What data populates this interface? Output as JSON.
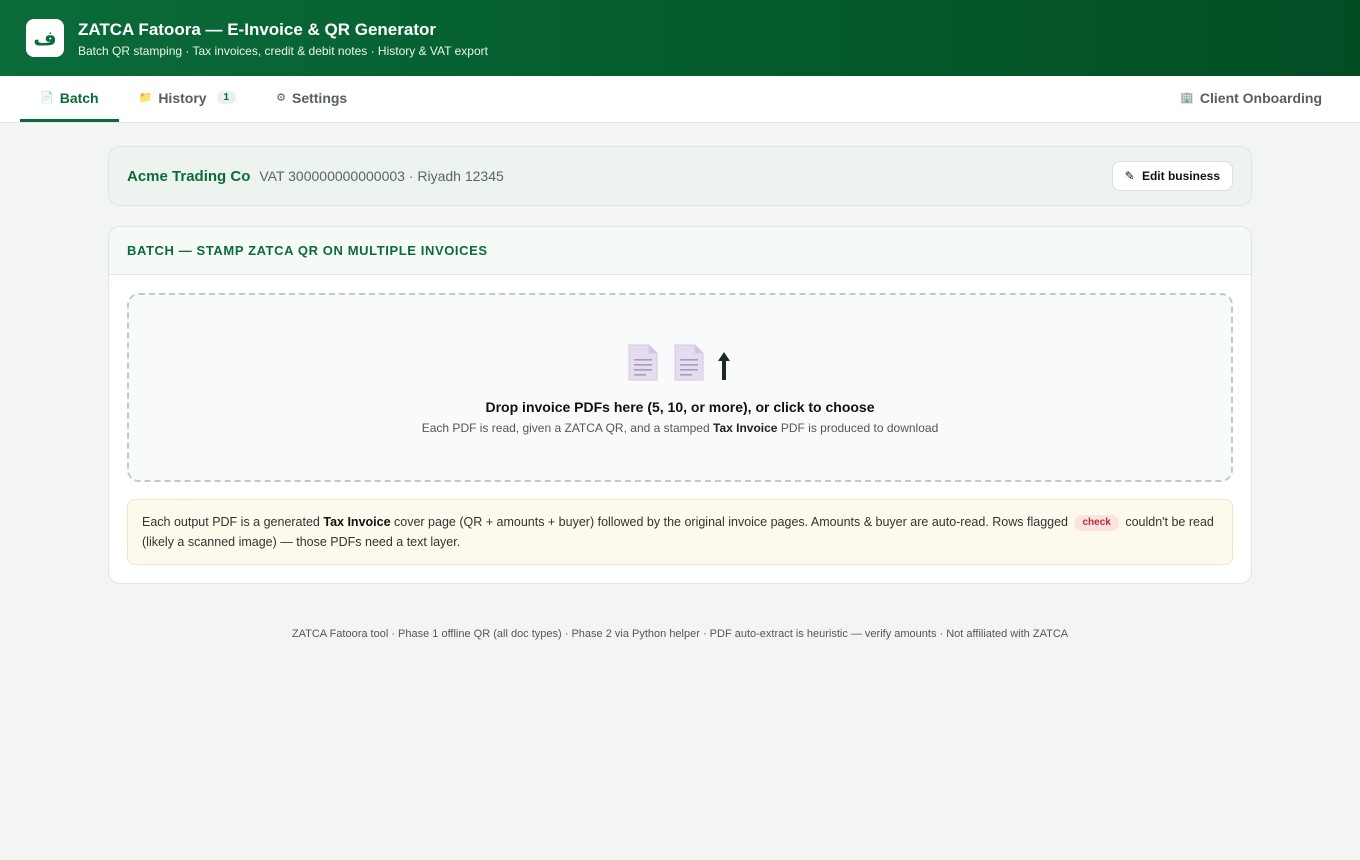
{
  "header": {
    "logo_glyph": "ف",
    "title": "ZATCA Fatoora — E-Invoice & QR Generator",
    "subtitle": "Batch QR stamping · Tax invoices, credit & debit notes · History & VAT export"
  },
  "tabs": {
    "batch": {
      "icon": "📄",
      "label": "Batch"
    },
    "history": {
      "icon": "📁",
      "label": "History",
      "badge": "1"
    },
    "settings": {
      "icon": "⚙",
      "label": "Settings"
    },
    "onboarding": {
      "icon": "🏢",
      "label": "Client Onboarding"
    }
  },
  "business": {
    "name": "Acme Trading Co",
    "meta": "VAT 300000000000003 · Riyadh 12345",
    "edit_icon": "✎",
    "edit_label": "Edit business"
  },
  "batch": {
    "heading": "Batch — stamp ZATCA QR on multiple invoices",
    "drop_title": "Drop invoice PDFs here (5, 10, or more), or click to choose",
    "drop_sub_pre": "Each PDF is read, given a ZATCA QR, and a stamped ",
    "drop_sub_bold": "Tax Invoice",
    "drop_sub_post": " PDF is produced to download",
    "note_pre": "Each output PDF is a generated ",
    "note_bold": "Tax Invoice",
    "note_mid": " cover page (QR + amounts + buyer) followed by the original invoice pages. Amounts & buyer are auto-read. Rows flagged ",
    "note_chip": "check",
    "note_post": " couldn't be read (likely a scanned image) — those PDFs need a text layer."
  },
  "footer": {
    "text": "ZATCA Fatoora tool · Phase 1 offline QR (all doc types) · Phase 2 via Python helper · PDF auto-extract is heuristic — verify amounts · Not affiliated with ZATCA"
  },
  "colors": {
    "brand": "#0b6b3a",
    "header_dark": "#034d25",
    "doc_icon": "#e6dcf0",
    "chip_bg": "#fbe3e3",
    "chip_text": "#b33030"
  }
}
